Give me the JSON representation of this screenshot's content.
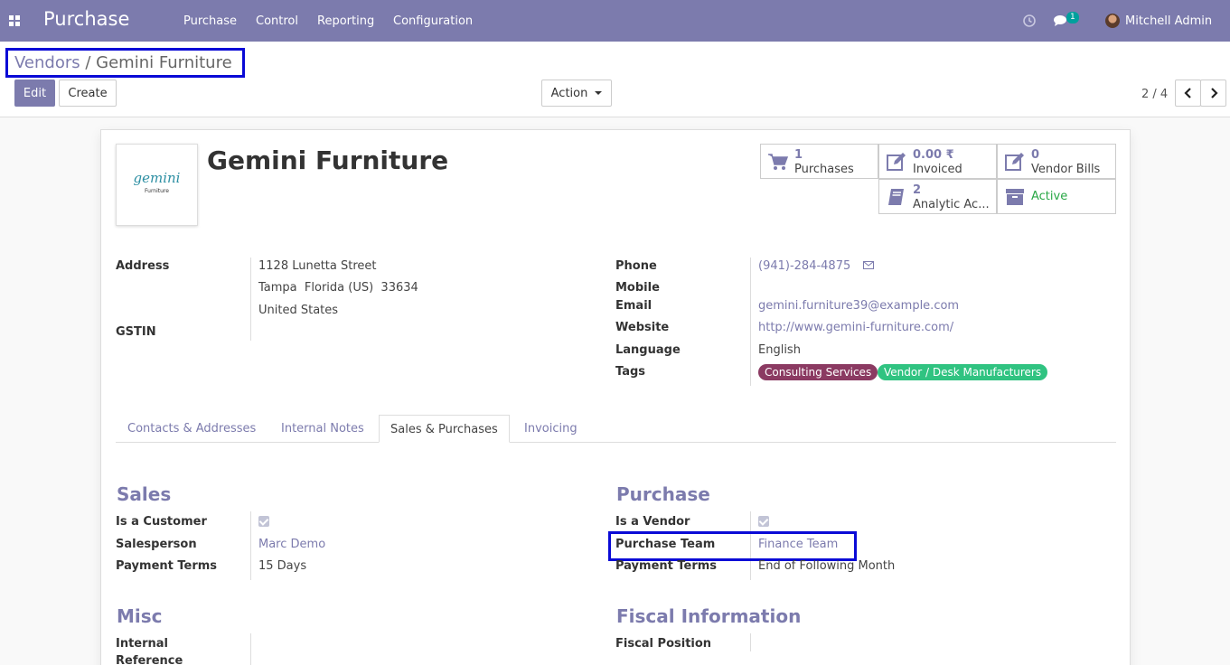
{
  "navbar": {
    "app_title": "Purchase",
    "menu": [
      "Purchase",
      "Control",
      "Reporting",
      "Configuration"
    ],
    "notification_count": "1",
    "user_name": "Mitchell Admin"
  },
  "control_panel": {
    "breadcrumb_parent": "Vendors",
    "breadcrumb_separator": " / ",
    "breadcrumb_current": "Gemini Furniture",
    "edit_label": "Edit",
    "create_label": "Create",
    "action_label": "Action",
    "pager": "2 / 4"
  },
  "partner": {
    "name": "Gemini Furniture",
    "logo_text": "gemini",
    "logo_subtext": "Furniture"
  },
  "stat_buttons": {
    "purchases": {
      "value": "1",
      "label": "Purchases"
    },
    "invoiced": {
      "value": "0.00 ₹",
      "label": "Invoiced"
    },
    "vendor_bills": {
      "value": "0",
      "label": "Vendor Bills"
    },
    "analytic": {
      "value": "2",
      "label": "Analytic Ac..."
    },
    "active": {
      "label": "Active"
    }
  },
  "address": {
    "label": "Address",
    "line1": "1128 Lunetta Street",
    "line2": "Tampa  Florida (US)  33634",
    "line3": "United States",
    "gstin_label": "GSTIN"
  },
  "contact": {
    "phone_label": "Phone",
    "phone": "(941)-284-4875",
    "mobile_label": "Mobile",
    "email_label": "Email",
    "email": "gemini.furniture39@example.com",
    "website_label": "Website",
    "website": "http://www.gemini-furniture.com/",
    "language_label": "Language",
    "language": "English",
    "tags_label": "Tags",
    "tags": [
      "Consulting Services",
      "Vendor / Desk Manufacturers"
    ]
  },
  "tabs": [
    "Contacts & Addresses",
    "Internal Notes",
    "Sales & Purchases",
    "Invoicing"
  ],
  "sales": {
    "title": "Sales",
    "customer_label": "Is a Customer",
    "salesperson_label": "Salesperson",
    "salesperson": "Marc Demo",
    "payment_terms_label": "Payment Terms",
    "payment_terms": "15 Days"
  },
  "purchase": {
    "title": "Purchase",
    "vendor_label": "Is a Vendor",
    "team_label": "Purchase Team",
    "team": "Finance Team",
    "payment_terms_label": "Payment Terms",
    "payment_terms": "End of Following Month"
  },
  "misc": {
    "title": "Misc",
    "internal_ref_label_1": "Internal",
    "internal_ref_label_2": "Reference"
  },
  "fiscal": {
    "title": "Fiscal Information",
    "position_label": "Fiscal Position"
  },
  "colors": {
    "brand": "#7c7bad",
    "highlight": "#0a0ad6",
    "active": "#28a745",
    "tag_consulting": "#8b3a62",
    "tag_vendor": "#30c381"
  }
}
